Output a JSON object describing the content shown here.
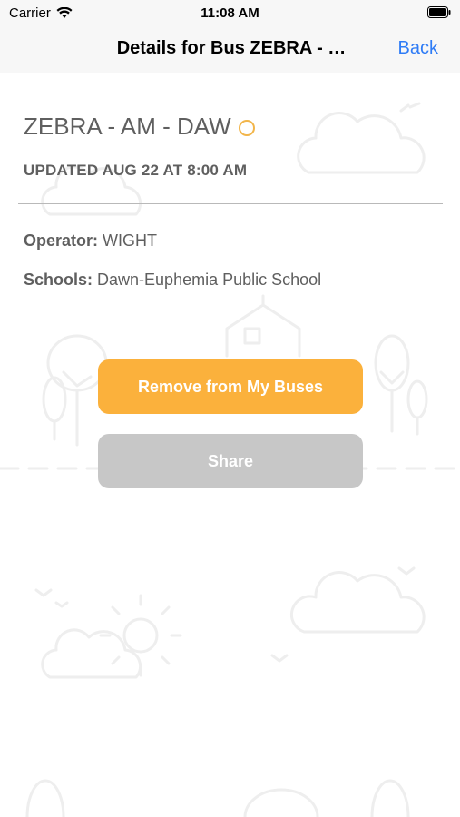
{
  "status_bar": {
    "carrier": "Carrier",
    "time": "11:08 AM"
  },
  "nav": {
    "title": "Details for Bus ZEBRA - …",
    "back_label": "Back"
  },
  "bus": {
    "name": "ZEBRA - AM - DAW",
    "updated": "UPDATED AUG 22 AT 8:00 AM",
    "operator_label": "Operator:",
    "operator_value": "WIGHT",
    "schools_label": "Schools:",
    "schools_value": "Dawn-Euphemia Public School"
  },
  "actions": {
    "remove_label": "Remove from My Buses",
    "share_label": "Share"
  },
  "colors": {
    "accent_orange": "#fbb13c",
    "share_gray": "#c7c7c7",
    "link_blue": "#2f7cf6",
    "status_circle": "#f2b54a"
  }
}
